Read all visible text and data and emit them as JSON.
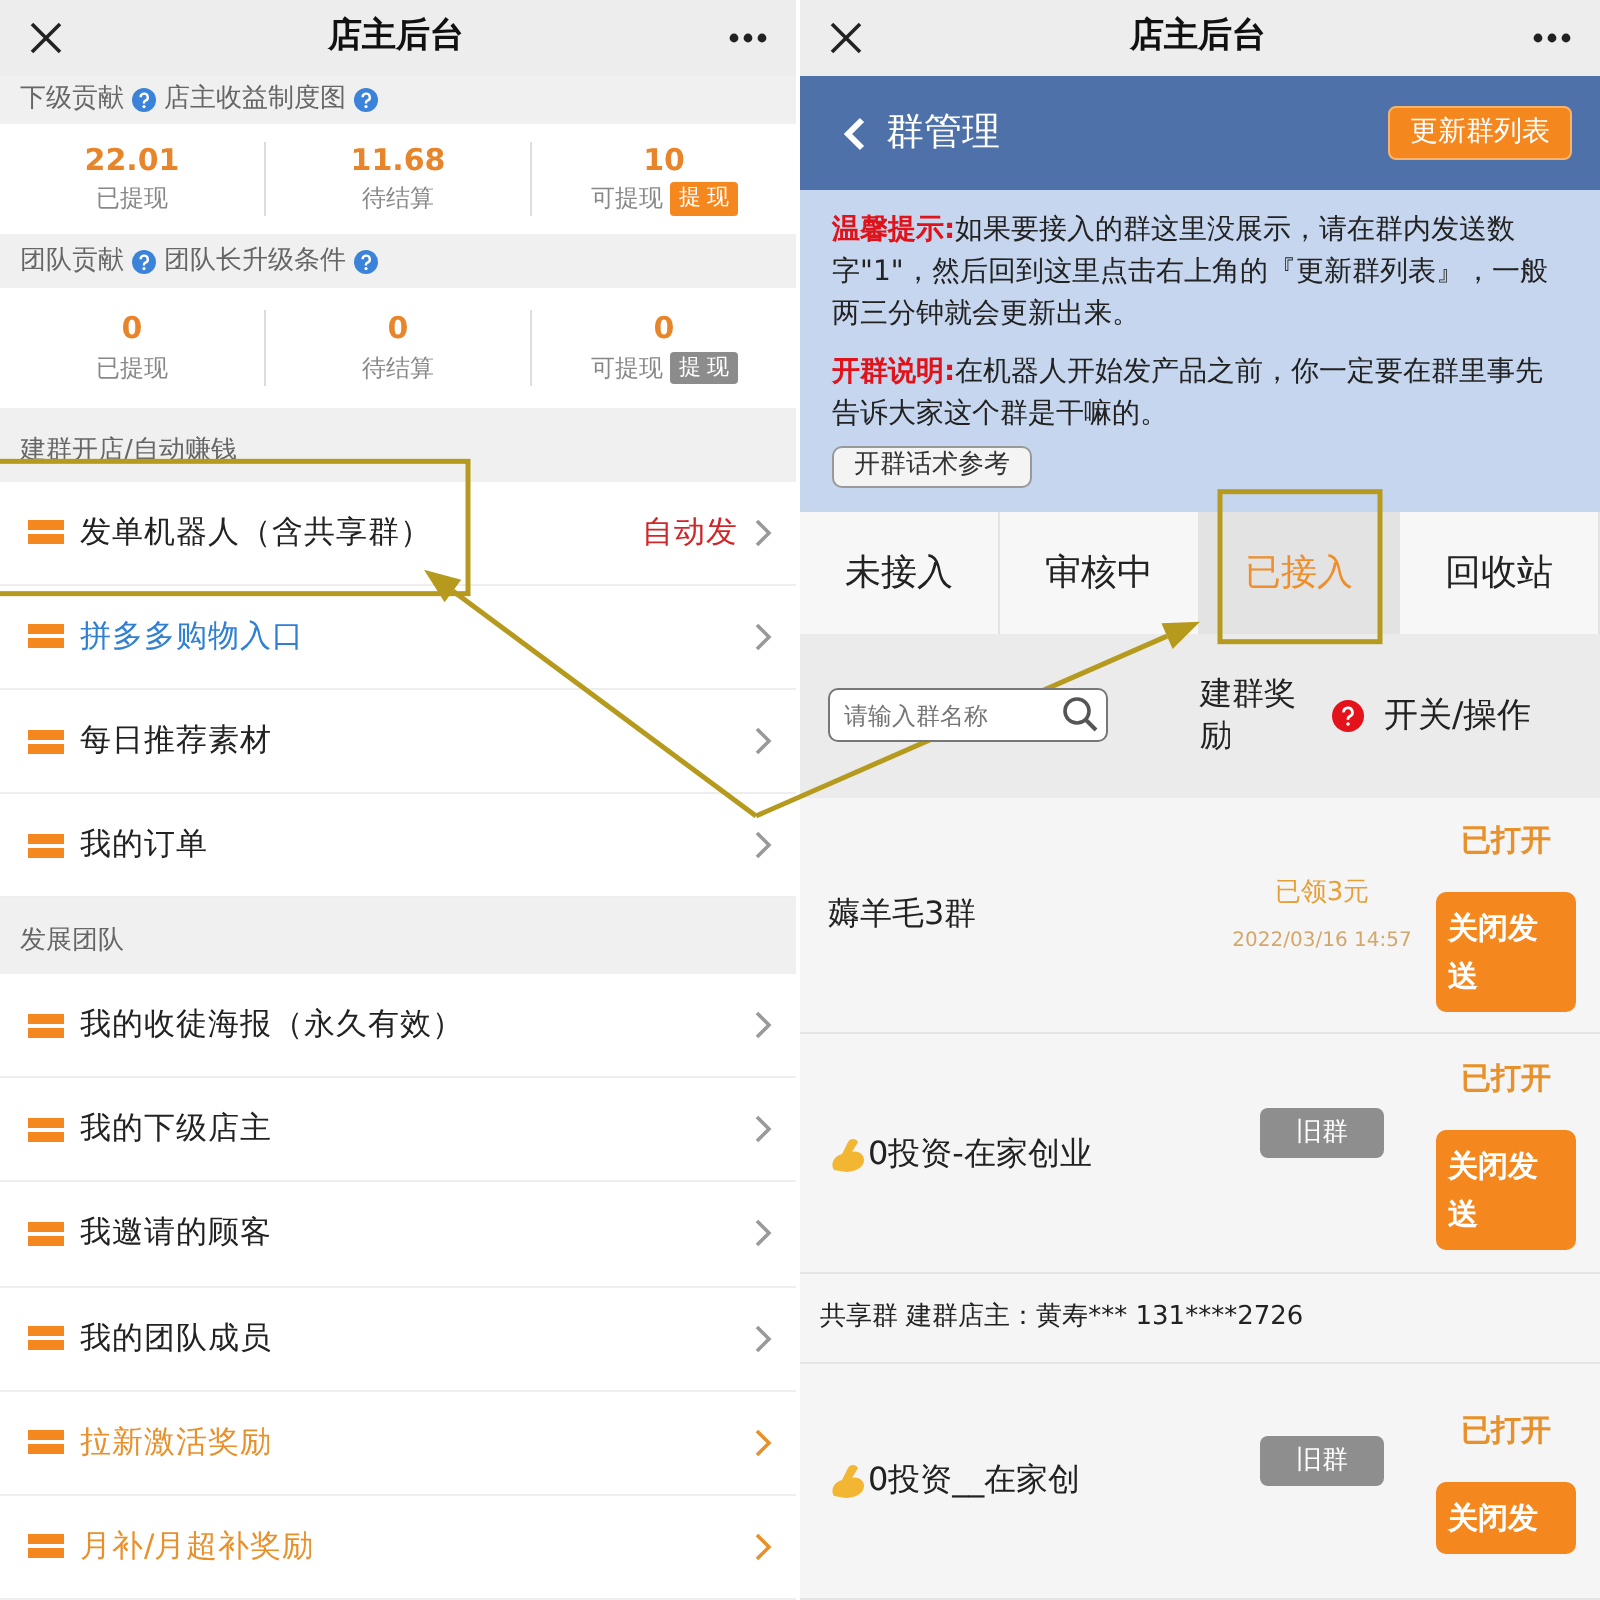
{
  "left": {
    "title": "店主后台",
    "stat_groups": [
      {
        "labels": [
          "下级贡献",
          "店主收益制度图"
        ],
        "stats": [
          {
            "value": "22.01",
            "label": "已提现"
          },
          {
            "value": "11.68",
            "label": "待结算"
          },
          {
            "value": "10",
            "label": "可提现",
            "action": "提 现",
            "disabled": false
          }
        ]
      },
      {
        "labels": [
          "团队贡献",
          "团队长升级条件"
        ],
        "stats": [
          {
            "value": "0",
            "label": "已提现"
          },
          {
            "value": "0",
            "label": "待结算"
          },
          {
            "value": "0",
            "label": "可提现",
            "action": "提 现",
            "disabled": true
          }
        ]
      }
    ],
    "menu_sections": [
      {
        "label": "建群开店/自动赚钱",
        "items": [
          {
            "label": "发单机器人（含共享群）",
            "kind": "normal",
            "status": "自动发",
            "highlighted": true
          },
          {
            "label": "拼多多购物入口",
            "kind": "link",
            "highlighted": false
          },
          {
            "label": "每日推荐素材",
            "kind": "normal",
            "highlighted": false
          },
          {
            "label": "我的订单",
            "kind": "normal",
            "highlighted": false
          }
        ]
      },
      {
        "label": "发展团队",
        "items": [
          {
            "label": "我的收徒海报（永久有效）",
            "kind": "normal",
            "highlighted": false
          },
          {
            "label": "我的下级店主",
            "kind": "normal",
            "highlighted": false
          },
          {
            "label": "我邀请的顾客",
            "kind": "normal",
            "highlighted": false
          },
          {
            "label": "我的团队成员",
            "kind": "normal",
            "highlighted": false
          },
          {
            "label": "拉新激活奖励",
            "kind": "promo",
            "highlighted": false
          },
          {
            "label": "月补/月超补奖励",
            "kind": "promo",
            "highlighted": false
          }
        ]
      }
    ]
  },
  "right": {
    "title": "店主后台",
    "page_title": "群管理",
    "refresh_button": "更新群列表",
    "notices": [
      {
        "label": "温馨提示:",
        "text": "如果要接入的群这里没展示，请在群内发送数字\"1\"，然后回到这里点击右上角的『更新群列表』，一般两三分钟就会更新出来。"
      },
      {
        "label": "开群说明:",
        "text": "在机器人开始发产品之前，你一定要在群里事先告诉大家这个群是干嘛的。",
        "button": "开群话术参考"
      }
    ],
    "tabs": [
      {
        "label": "未接入",
        "selected": false,
        "highlighted": false
      },
      {
        "label": "审核中",
        "selected": false,
        "highlighted": false
      },
      {
        "label": "已接入",
        "selected": true,
        "highlighted": true
      },
      {
        "label": "回收站",
        "selected": false,
        "highlighted": false
      }
    ],
    "search": {
      "placeholder": "请输入群名称"
    },
    "columns": [
      "建群奖励",
      "开关/操作"
    ],
    "groups": [
      {
        "name": "薅羊毛3群",
        "emoji": false,
        "middle": {
          "kind": "reward",
          "text": "已领3元",
          "date": "2022/03/16 14:57"
        },
        "status": "已打开",
        "button": "关闭发送"
      },
      {
        "name": "0投资-在家创业",
        "emoji": true,
        "middle": {
          "kind": "tag",
          "text": "旧群"
        },
        "status": "已打开",
        "button": "关闭发送",
        "footer": "共享群 建群店主：黄寿*** 131****2726"
      },
      {
        "name": "0投资__在家创",
        "emoji": true,
        "middle": {
          "kind": "tag",
          "text": "旧群"
        },
        "status": "已打开",
        "button": "关闭发"
      }
    ]
  }
}
